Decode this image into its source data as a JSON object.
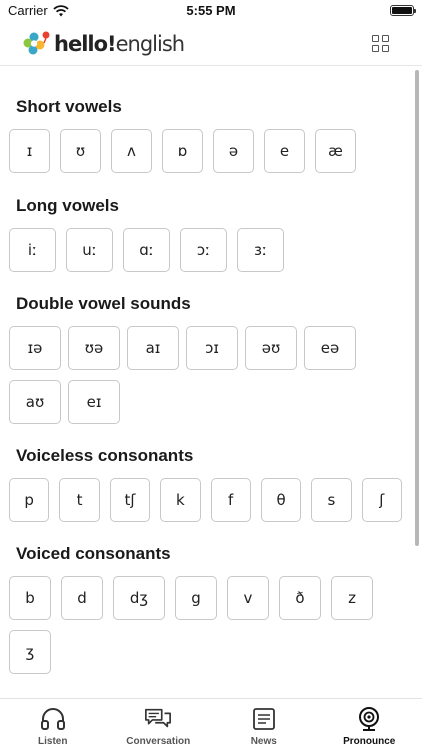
{
  "status_bar": {
    "carrier": "Carrier",
    "time": "5:55 PM"
  },
  "header": {
    "logo_text_bold": "hello!",
    "logo_text_light": "english",
    "logo_colors": [
      "#3aa7c7",
      "#e8412f",
      "#8cc63f",
      "#f7b731"
    ]
  },
  "sections": [
    {
      "title": "Short vowels",
      "keys": [
        "ɪ",
        "ʊ",
        "ʌ",
        "ɒ",
        "ə",
        "e",
        "æ"
      ]
    },
    {
      "title": "Long vowels",
      "keys": [
        "iː",
        "uː",
        "ɑː",
        "ɔː",
        "ɜː"
      ]
    },
    {
      "title": "Double vowel sounds",
      "keys": [
        "ɪə",
        "ʊə",
        "aɪ",
        "ɔɪ",
        "əʊ",
        "eə",
        "aʊ",
        "eɪ"
      ]
    },
    {
      "title": "Voiceless consonants",
      "keys": [
        "p",
        "t",
        "tʃ",
        "k",
        "f",
        "θ",
        "s",
        "ʃ"
      ]
    },
    {
      "title": "Voiced consonants",
      "keys": [
        "b",
        "d",
        "dʒ",
        "g",
        "v",
        "ð",
        "z",
        "ʒ"
      ]
    }
  ],
  "tabs": [
    {
      "label": "Listen",
      "icon": "headphones-icon"
    },
    {
      "label": "Conversation",
      "icon": "chat-icon"
    },
    {
      "label": "News",
      "icon": "news-icon"
    },
    {
      "label": "Pronounce",
      "icon": "webcam-icon",
      "active": true
    }
  ]
}
